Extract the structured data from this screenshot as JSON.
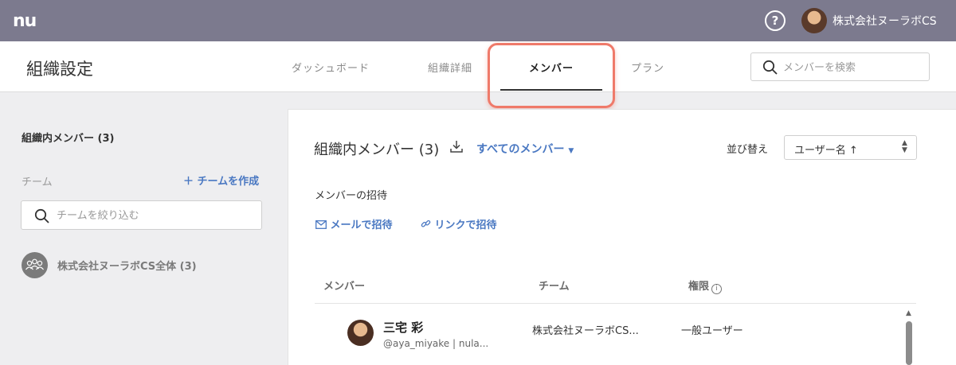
{
  "topbar": {
    "logo": "nu",
    "help": "?",
    "org_name": "株式会社ヌーラボCS"
  },
  "header": {
    "title": "組織設定",
    "tabs": [
      {
        "label": "ダッシュボード"
      },
      {
        "label": "組織詳細"
      },
      {
        "label": "メンバー"
      },
      {
        "label": "プラン"
      }
    ],
    "active_tab": "メンバー",
    "search_placeholder": "メンバーを検索"
  },
  "sidebar": {
    "members_label": "組織内メンバー (3)",
    "team_label": "チーム",
    "create_team": "＋ チームを作成",
    "filter_placeholder": "チームを絞り込む",
    "teams": [
      {
        "name": "株式会社ヌーラボCS全体 (3)"
      }
    ]
  },
  "main": {
    "title": "組織内メンバー (3)",
    "filter": "すべてのメンバー",
    "sort_label": "並び替え",
    "sort_value": "ユーザー名 ↑",
    "invite_title": "メンバーの招待",
    "invite_mail": "メールで招待",
    "invite_link": "リンクで招待",
    "columns": [
      "メンバー",
      "チーム",
      "権限"
    ],
    "rows": [
      {
        "name": "三宅 彩",
        "handle": "@aya_miyake | nula...",
        "team": "株式会社ヌーラボCS...",
        "role": "一般ユーザー"
      }
    ]
  },
  "colors": {
    "topbar": "#7c7a8e",
    "accent": "#4a78c2",
    "highlight": "#ef7a6a"
  }
}
